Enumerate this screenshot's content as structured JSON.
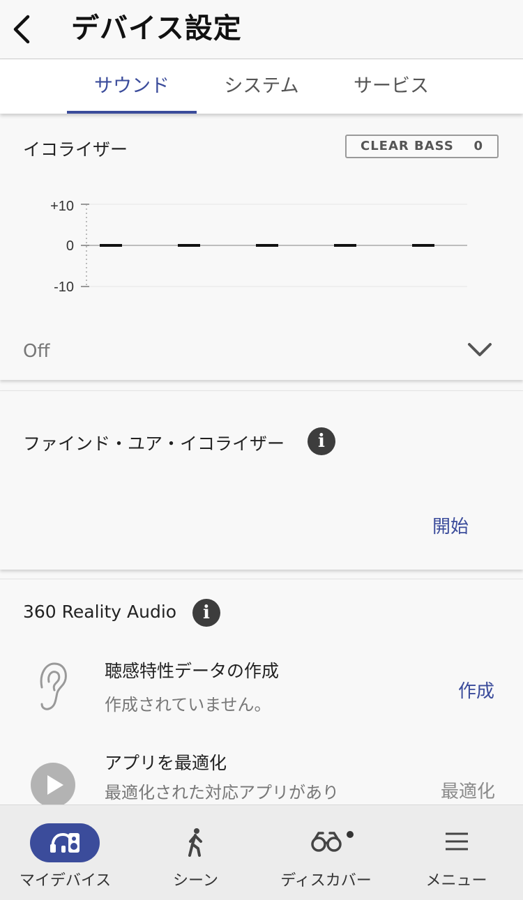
{
  "header": {
    "title": "デバイス設定"
  },
  "tabs": [
    {
      "label": "サウンド",
      "active": true
    },
    {
      "label": "システム",
      "active": false
    },
    {
      "label": "サービス",
      "active": false
    }
  ],
  "equalizer": {
    "title": "イコライザー",
    "clear_bass": {
      "label": "CLEAR BASS",
      "value": "0"
    },
    "axis": {
      "max_label": "+10",
      "mid_label": "0",
      "min_label": "-10"
    },
    "bands": [
      0,
      0,
      0,
      0,
      0
    ],
    "preset": "Off"
  },
  "find_your_eq": {
    "title": "ファインド・ユア・イコライザー",
    "info_glyph": "i",
    "start_label": "開始"
  },
  "reality_audio": {
    "title": "360 Reality Audio",
    "info_glyph": "i",
    "rows": [
      {
        "title": "聴感特性データの作成",
        "subtitle": "作成されていません。",
        "action": "作成",
        "icon": "ear-icon"
      },
      {
        "title": "アプリを最適化",
        "subtitle": "最適化された対応アプリがあり",
        "action": "最適化",
        "icon": "play-icon"
      }
    ]
  },
  "bottom_nav": [
    {
      "label": "マイデバイス",
      "icon": "my-device-icon",
      "active": true
    },
    {
      "label": "シーン",
      "icon": "walking-person-icon",
      "active": false
    },
    {
      "label": "ディスカバー",
      "icon": "binoculars-icon",
      "active": false,
      "dot": true
    },
    {
      "label": "メニュー",
      "icon": "hamburger-menu-icon",
      "active": false
    }
  ],
  "colors": {
    "accent": "#3b4c9b",
    "background": "#f8f8f8",
    "nav_background": "#ececec"
  }
}
